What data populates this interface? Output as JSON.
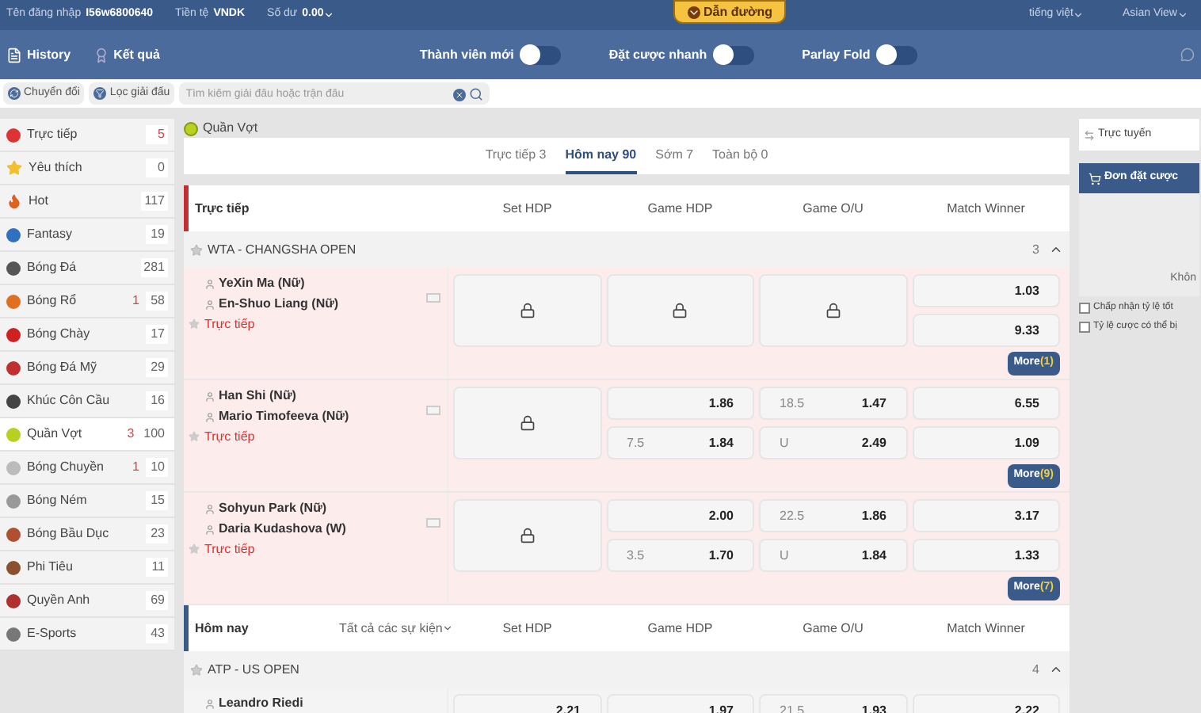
{
  "top_bar": {
    "username_label": "Tên đăng nhập",
    "username": "I56w6800640",
    "currency_label": "Tiền tệ",
    "currency": "VNDK",
    "balance_label": "Số dư",
    "balance": "0.00",
    "guide": "Dẫn đường",
    "language": "tiếng việt",
    "view": "Asian View"
  },
  "nav_bar": {
    "links": [
      {
        "label": "History"
      },
      {
        "label": "Kết quả"
      }
    ],
    "toggles": [
      {
        "label": "Thành viên mới",
        "on": false
      },
      {
        "label": "Đặt cược nhanh",
        "on": false
      },
      {
        "label": "Parlay Fold",
        "on": false
      }
    ]
  },
  "filter_bar": {
    "buttons": [
      {
        "label": "Chuyển đổi"
      },
      {
        "label": "Lọc giải đấu"
      }
    ],
    "search": {
      "placeholder": "Tìm kiếm giải đấu hoặc trận đấu"
    }
  },
  "sidebar": {
    "items": [
      {
        "label": "Trực tiếp",
        "count": "5",
        "selected": false
      },
      {
        "label": "Yêu thích",
        "count": "0",
        "selected": false
      },
      {
        "label": "Hot",
        "count": "117",
        "selected": false
      },
      {
        "label": "Fantasy",
        "count": "19",
        "selected": false
      },
      {
        "label": "Bóng Đá",
        "count": "281",
        "selected": false
      },
      {
        "label": "Bóng Rổ",
        "live": "1",
        "count": "58",
        "selected": false
      },
      {
        "label": "Bóng Chày",
        "count": "17",
        "selected": false
      },
      {
        "label": "Bóng Đá Mỹ",
        "count": "29",
        "selected": false
      },
      {
        "label": "Khúc Côn Cầu",
        "count": "16",
        "selected": false
      },
      {
        "label": "Quần Vợt",
        "live": "3",
        "count": "100",
        "selected": true
      },
      {
        "label": "Bóng Chuyền",
        "live": "1",
        "count": "10",
        "selected": false
      },
      {
        "label": "Bóng Ném",
        "count": "15",
        "selected": false
      },
      {
        "label": "Bóng Bầu Dục",
        "count": "23",
        "selected": false
      },
      {
        "label": "Phi Tiêu",
        "count": "11",
        "selected": false
      },
      {
        "label": "Quyền Anh",
        "count": "69",
        "selected": false
      },
      {
        "label": "E-Sports",
        "count": "43",
        "selected": false
      }
    ]
  },
  "main": {
    "title": "Quần Vợt",
    "tabs": [
      {
        "label": "Trực tiếp 3",
        "selected": false
      },
      {
        "label": "Hôm nay 90",
        "selected": true
      },
      {
        "label": "Sớm 7",
        "selected": false
      },
      {
        "label": "Toàn bộ 0",
        "selected": false
      }
    ],
    "sections": [
      {
        "title": "Trực tiếp",
        "kind": "live",
        "columns": [
          "Set HDP",
          "Game HDP",
          "Game O/U",
          "Match Winner"
        ],
        "leagues": [
          {
            "name": "WTA - CHANGSHA OPEN",
            "count": "3",
            "expanded": true,
            "matches": [
              {
                "players": [
                  "YeXin Ma (Nữ)",
                  "En-Shuo Liang (Nữ)"
                ],
                "status": "Trực tiếp",
                "live": true,
                "more": "More",
                "more_count": "(1)",
                "markets": [
                  {
                    "kind": "locked"
                  },
                  {
                    "kind": "locked"
                  },
                  {
                    "kind": "locked"
                  },
                  {
                    "kind": "odds",
                    "lines": [
                      {
                        "odds": "1.03"
                      },
                      {
                        "odds": "9.33"
                      }
                    ]
                  }
                ]
              },
              {
                "players": [
                  "Han Shi (Nữ)",
                  "Mario Timofeeva (Nữ)"
                ],
                "status": "Trực tiếp",
                "live": true,
                "more": "More",
                "more_count": "(9)",
                "markets": [
                  {
                    "kind": "locked"
                  },
                  {
                    "kind": "odds",
                    "lines": [
                      {
                        "odds": "1.86"
                      },
                      {
                        "line": "7.5",
                        "odds": "1.84"
                      }
                    ]
                  },
                  {
                    "kind": "odds",
                    "lines": [
                      {
                        "line": "18.5",
                        "odds": "1.47"
                      },
                      {
                        "line": "U",
                        "odds": "2.49"
                      }
                    ]
                  },
                  {
                    "kind": "odds",
                    "lines": [
                      {
                        "odds": "6.55"
                      },
                      {
                        "odds": "1.09"
                      }
                    ]
                  }
                ]
              },
              {
                "players": [
                  "Sohyun Park (Nữ)",
                  "Daria Kudashova (W)"
                ],
                "status": "Trực tiếp",
                "live": true,
                "more": "More",
                "more_count": "(7)",
                "markets": [
                  {
                    "kind": "locked"
                  },
                  {
                    "kind": "odds",
                    "lines": [
                      {
                        "odds": "2.00"
                      },
                      {
                        "line": "3.5",
                        "odds": "1.70"
                      }
                    ]
                  },
                  {
                    "kind": "odds",
                    "lines": [
                      {
                        "line": "22.5",
                        "odds": "1.86"
                      },
                      {
                        "line": "U",
                        "odds": "1.84"
                      }
                    ]
                  },
                  {
                    "kind": "odds",
                    "lines": [
                      {
                        "odds": "3.17"
                      },
                      {
                        "odds": "1.33"
                      }
                    ]
                  }
                ]
              }
            ]
          }
        ]
      },
      {
        "title": "Hôm nay",
        "kind": "today",
        "filter": "Tất cả các sự kiện",
        "columns": [
          "Set HDP",
          "Game HDP",
          "Game O/U",
          "Match Winner"
        ],
        "leagues": [
          {
            "name": "ATP - US OPEN",
            "count": "4",
            "expanded": true,
            "matches": [
              {
                "players": [
                  "Leandro Riedi"
                ],
                "live": false,
                "markets": [
                  {
                    "kind": "odds",
                    "lines": [
                      {
                        "odds": "2.21"
                      }
                    ]
                  },
                  {
                    "kind": "odds",
                    "lines": [
                      {
                        "odds": "1.97"
                      }
                    ]
                  },
                  {
                    "kind": "odds",
                    "lines": [
                      {
                        "line": "21.5",
                        "odds": "1.93"
                      }
                    ]
                  },
                  {
                    "kind": "odds",
                    "lines": [
                      {
                        "odds": "2.22"
                      }
                    ]
                  }
                ]
              }
            ]
          }
        ]
      }
    ]
  },
  "right_panel": {
    "status": "Trực tuyến",
    "bet_slip": "Đơn đặt cược",
    "empty": "Khôn",
    "options": [
      {
        "label": "Chấp nhận tỷ lệ tốt",
        "checked": false
      },
      {
        "label": "Tỷ lệ cược có thể bị",
        "checked": false
      }
    ]
  }
}
